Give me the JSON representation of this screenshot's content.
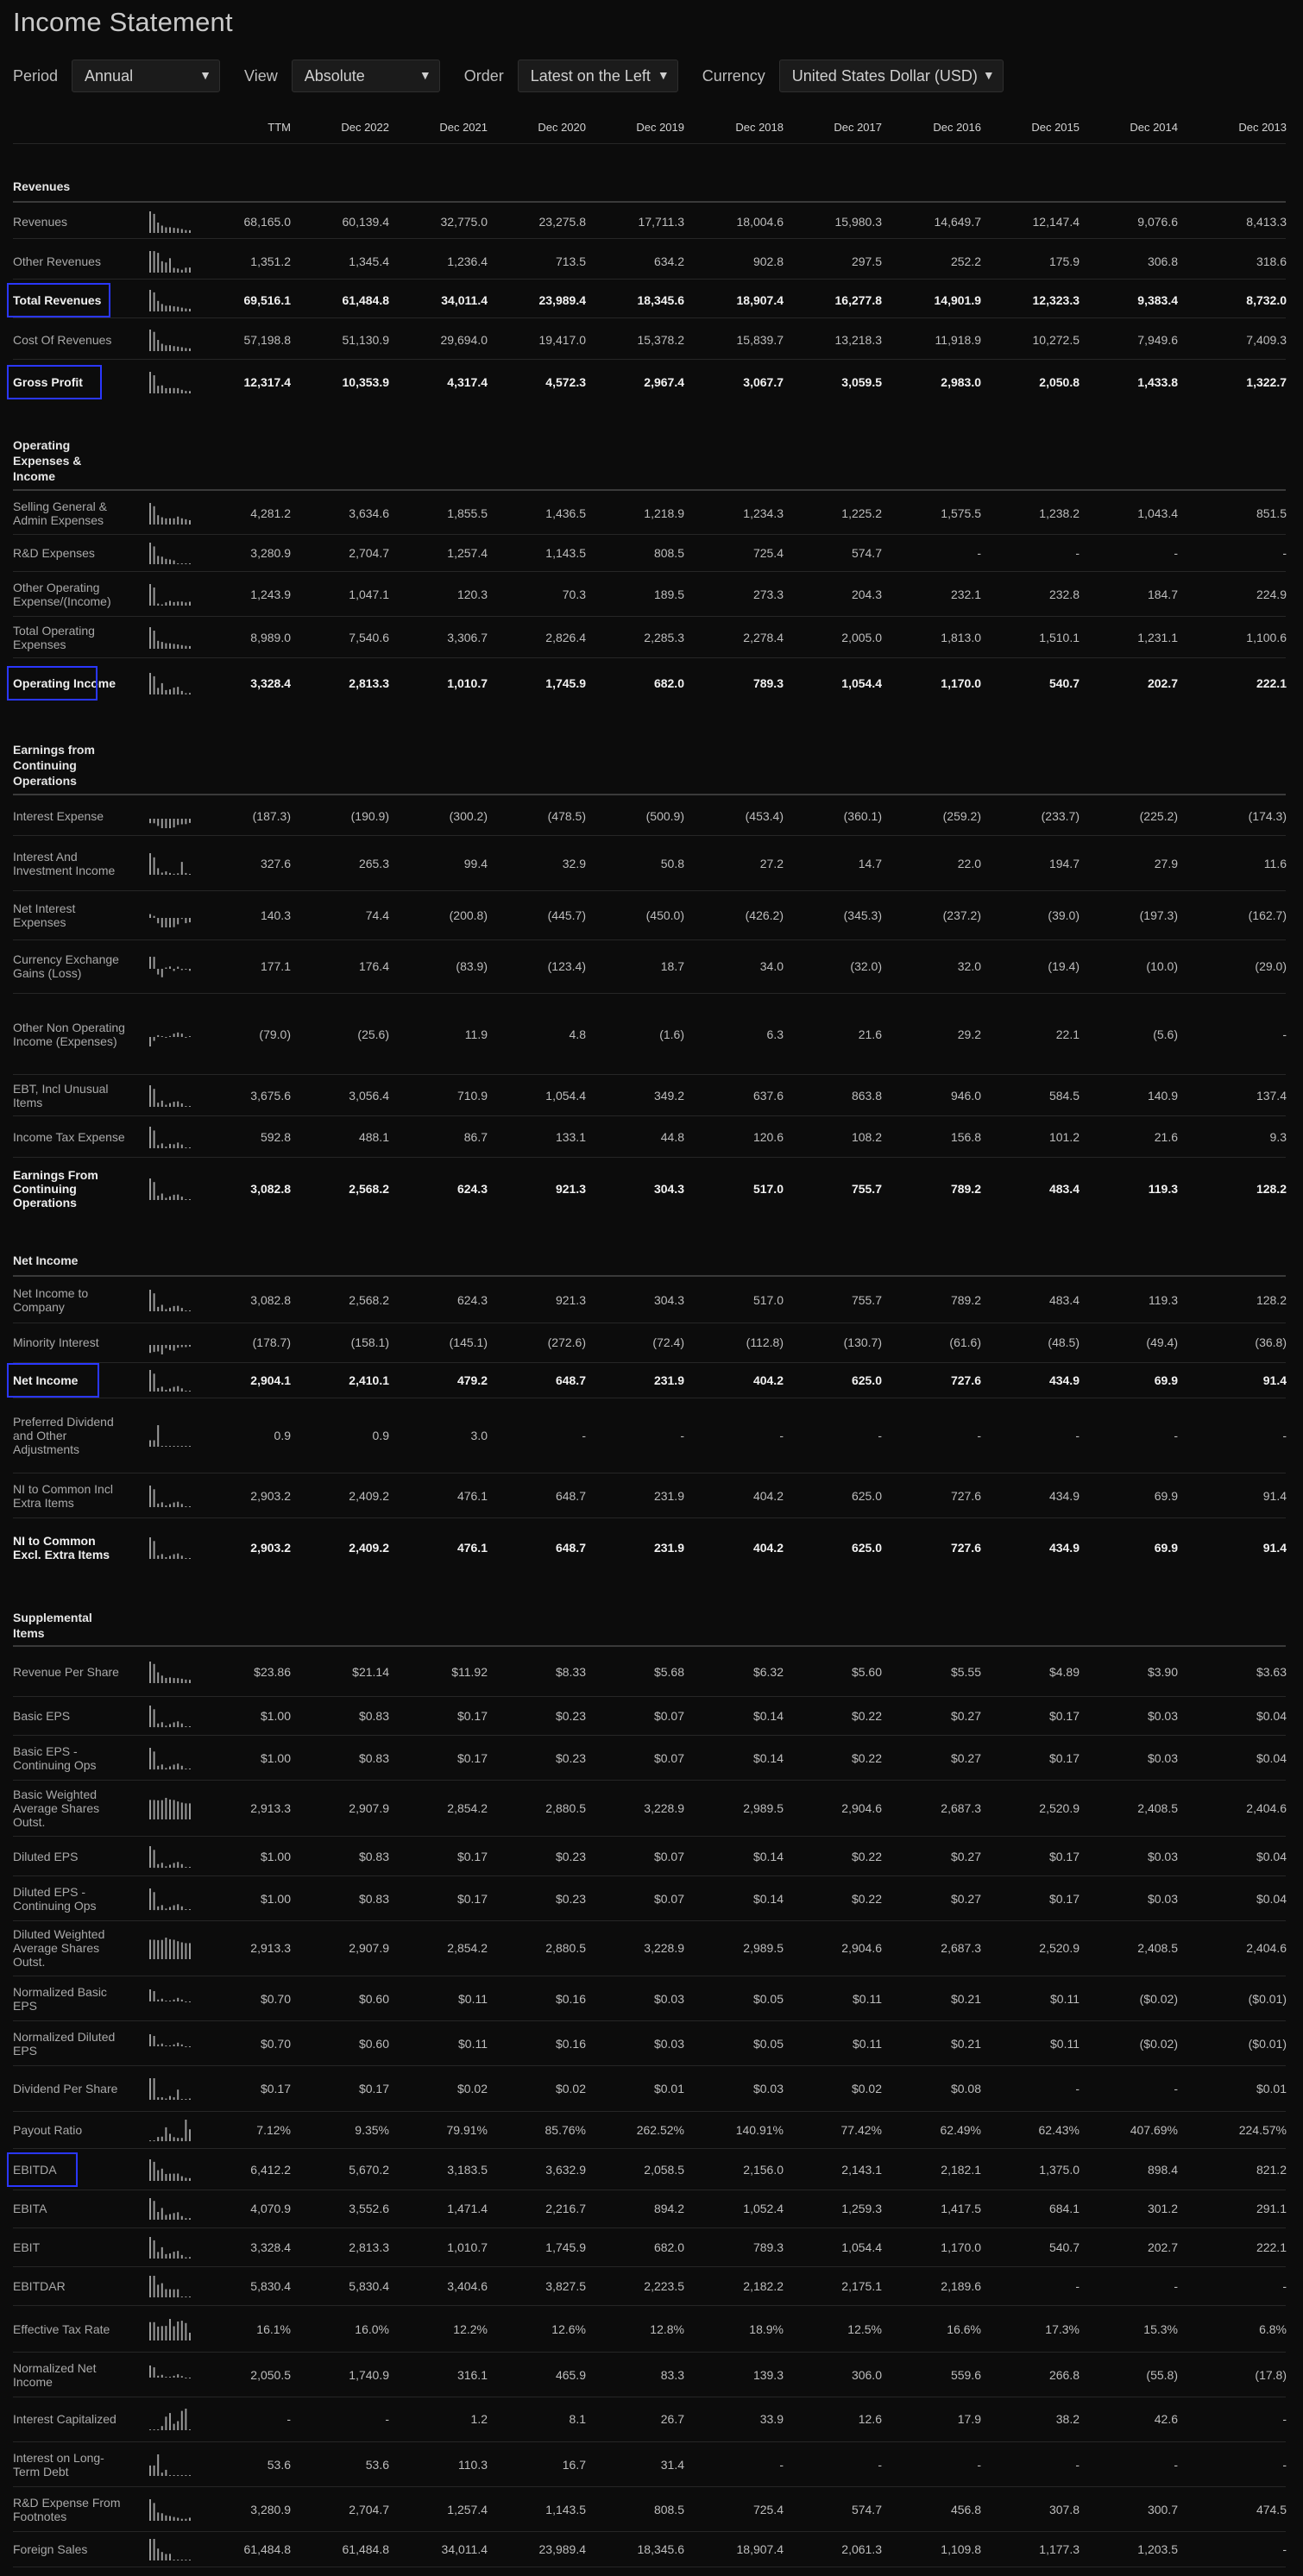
{
  "title": "Income Statement",
  "controls": {
    "period_label": "Period",
    "period_value": "Annual",
    "view_label": "View",
    "view_value": "Absolute",
    "order_label": "Order",
    "order_value": "Latest on the Left",
    "currency_label": "Currency",
    "currency_value": "United States Dollar (USD)"
  },
  "columns": [
    "TTM",
    "Dec 2022",
    "Dec 2021",
    "Dec 2020",
    "Dec 2019",
    "Dec 2018",
    "Dec 2017",
    "Dec 2016",
    "Dec 2015",
    "Dec 2014",
    "Dec 2013"
  ],
  "sections": [
    {
      "title": "Revenues",
      "rows": [
        {
          "label": "Revenues",
          "bold": false,
          "highlight": false,
          "values": [
            "68,165.0",
            "60,139.4",
            "32,775.0",
            "23,275.8",
            "17,711.3",
            "18,004.6",
            "15,980.3",
            "14,649.7",
            "12,147.4",
            "9,076.6",
            "8,413.3"
          ]
        },
        {
          "label": "Other Revenues",
          "bold": false,
          "highlight": false,
          "values": [
            "1,351.2",
            "1,345.4",
            "1,236.4",
            "713.5",
            "634.2",
            "902.8",
            "297.5",
            "252.2",
            "175.9",
            "306.8",
            "318.6"
          ]
        },
        {
          "label": "Total Revenues",
          "bold": true,
          "highlight": true,
          "values": [
            "69,516.1",
            "61,484.8",
            "34,011.4",
            "23,989.4",
            "18,345.6",
            "18,907.4",
            "16,277.8",
            "14,901.9",
            "12,323.3",
            "9,383.4",
            "8,732.0"
          ]
        },
        {
          "label": "Cost Of Revenues",
          "bold": false,
          "highlight": false,
          "values": [
            "57,198.8",
            "51,130.9",
            "29,694.0",
            "19,417.0",
            "15,378.2",
            "15,839.7",
            "13,218.3",
            "11,918.9",
            "10,272.5",
            "7,949.6",
            "7,409.3"
          ]
        },
        {
          "label": "Gross Profit",
          "bold": true,
          "highlight": true,
          "values": [
            "12,317.4",
            "10,353.9",
            "4,317.4",
            "4,572.3",
            "2,967.4",
            "3,067.7",
            "3,059.5",
            "2,983.0",
            "2,050.8",
            "1,433.8",
            "1,322.7"
          ]
        }
      ]
    },
    {
      "title": "Operating Expenses & Income",
      "rows": [
        {
          "label": "Selling General & Admin Expenses",
          "bold": false,
          "highlight": false,
          "values": [
            "4,281.2",
            "3,634.6",
            "1,855.5",
            "1,436.5",
            "1,218.9",
            "1,234.3",
            "1,225.2",
            "1,575.5",
            "1,238.2",
            "1,043.4",
            "851.5"
          ]
        },
        {
          "label": "R&D Expenses",
          "bold": false,
          "highlight": false,
          "values": [
            "3,280.9",
            "2,704.7",
            "1,257.4",
            "1,143.5",
            "808.5",
            "725.4",
            "574.7",
            "-",
            "-",
            "-",
            "-"
          ]
        },
        {
          "label": "Other Operating Expense/(Income)",
          "bold": false,
          "highlight": false,
          "values": [
            "1,243.9",
            "1,047.1",
            "120.3",
            "70.3",
            "189.5",
            "273.3",
            "204.3",
            "232.1",
            "232.8",
            "184.7",
            "224.9"
          ]
        },
        {
          "label": "Total Operating Expenses",
          "bold": false,
          "highlight": false,
          "values": [
            "8,989.0",
            "7,540.6",
            "3,306.7",
            "2,826.4",
            "2,285.3",
            "2,278.4",
            "2,005.0",
            "1,813.0",
            "1,510.1",
            "1,231.1",
            "1,100.6"
          ]
        },
        {
          "label": "Operating Income",
          "bold": true,
          "highlight": true,
          "values": [
            "3,328.4",
            "2,813.3",
            "1,010.7",
            "1,745.9",
            "682.0",
            "789.3",
            "1,054.4",
            "1,170.0",
            "540.7",
            "202.7",
            "222.1"
          ]
        }
      ]
    },
    {
      "title": "Earnings from Continuing Operations",
      "rows": [
        {
          "label": "Interest Expense",
          "bold": false,
          "highlight": false,
          "values": [
            "(187.3)",
            "(190.9)",
            "(300.2)",
            "(478.5)",
            "(500.9)",
            "(453.4)",
            "(360.1)",
            "(259.2)",
            "(233.7)",
            "(225.2)",
            "(174.3)"
          ]
        },
        {
          "label": "Interest And Investment Income",
          "bold": false,
          "highlight": false,
          "values": [
            "327.6",
            "265.3",
            "99.4",
            "32.9",
            "50.8",
            "27.2",
            "14.7",
            "22.0",
            "194.7",
            "27.9",
            "11.6"
          ]
        },
        {
          "label": "Net Interest Expenses",
          "bold": false,
          "highlight": false,
          "values": [
            "140.3",
            "74.4",
            "(200.8)",
            "(445.7)",
            "(450.0)",
            "(426.2)",
            "(345.3)",
            "(237.2)",
            "(39.0)",
            "(197.3)",
            "(162.7)"
          ]
        },
        {
          "label": "Currency Exchange Gains (Loss)",
          "bold": false,
          "highlight": false,
          "values": [
            "177.1",
            "176.4",
            "(83.9)",
            "(123.4)",
            "18.7",
            "34.0",
            "(32.0)",
            "32.0",
            "(19.4)",
            "(10.0)",
            "(29.0)"
          ]
        },
        {
          "label": "Other Non Operating Income (Expenses)",
          "bold": false,
          "highlight": false,
          "values": [
            "(79.0)",
            "(25.6)",
            "11.9",
            "4.8",
            "(1.6)",
            "6.3",
            "21.6",
            "29.2",
            "22.1",
            "(5.6)",
            "-"
          ]
        },
        {
          "label": "EBT, Incl Unusual Items",
          "bold": false,
          "highlight": false,
          "values": [
            "3,675.6",
            "3,056.4",
            "710.9",
            "1,054.4",
            "349.2",
            "637.6",
            "863.8",
            "946.0",
            "584.5",
            "140.9",
            "137.4"
          ]
        },
        {
          "label": "Income Tax Expense",
          "bold": false,
          "highlight": false,
          "values": [
            "592.8",
            "488.1",
            "86.7",
            "133.1",
            "44.8",
            "120.6",
            "108.2",
            "156.8",
            "101.2",
            "21.6",
            "9.3"
          ]
        },
        {
          "label": "Earnings From Continuing Operations",
          "bold": true,
          "highlight": false,
          "values": [
            "3,082.8",
            "2,568.2",
            "624.3",
            "921.3",
            "304.3",
            "517.0",
            "755.7",
            "789.2",
            "483.4",
            "119.3",
            "128.2"
          ]
        }
      ]
    },
    {
      "title": "Net Income",
      "rows": [
        {
          "label": "Net Income to Company",
          "bold": false,
          "highlight": false,
          "values": [
            "3,082.8",
            "2,568.2",
            "624.3",
            "921.3",
            "304.3",
            "517.0",
            "755.7",
            "789.2",
            "483.4",
            "119.3",
            "128.2"
          ]
        },
        {
          "label": "Minority Interest",
          "bold": false,
          "highlight": false,
          "values": [
            "(178.7)",
            "(158.1)",
            "(145.1)",
            "(272.6)",
            "(72.4)",
            "(112.8)",
            "(130.7)",
            "(61.6)",
            "(48.5)",
            "(49.4)",
            "(36.8)"
          ]
        },
        {
          "label": "Net Income",
          "bold": true,
          "highlight": true,
          "values": [
            "2,904.1",
            "2,410.1",
            "479.2",
            "648.7",
            "231.9",
            "404.2",
            "625.0",
            "727.6",
            "434.9",
            "69.9",
            "91.4"
          ]
        },
        {
          "label": "Preferred Dividend and Other Adjustments",
          "bold": false,
          "highlight": false,
          "values": [
            "0.9",
            "0.9",
            "3.0",
            "-",
            "-",
            "-",
            "-",
            "-",
            "-",
            "-",
            "-"
          ]
        },
        {
          "label": "NI to Common Incl Extra Items",
          "bold": false,
          "highlight": false,
          "values": [
            "2,903.2",
            "2,409.2",
            "476.1",
            "648.7",
            "231.9",
            "404.2",
            "625.0",
            "727.6",
            "434.9",
            "69.9",
            "91.4"
          ]
        },
        {
          "label": "NI to Common Excl. Extra Items",
          "bold": true,
          "highlight": false,
          "values": [
            "2,903.2",
            "2,409.2",
            "476.1",
            "648.7",
            "231.9",
            "404.2",
            "625.0",
            "727.6",
            "434.9",
            "69.9",
            "91.4"
          ]
        }
      ]
    },
    {
      "title": "Supplemental Items",
      "rows": [
        {
          "label": "Revenue Per Share",
          "bold": false,
          "highlight": false,
          "values": [
            "$23.86",
            "$21.14",
            "$11.92",
            "$8.33",
            "$5.68",
            "$6.32",
            "$5.60",
            "$5.55",
            "$4.89",
            "$3.90",
            "$3.63"
          ]
        },
        {
          "label": "Basic EPS",
          "bold": false,
          "highlight": false,
          "values": [
            "$1.00",
            "$0.83",
            "$0.17",
            "$0.23",
            "$0.07",
            "$0.14",
            "$0.22",
            "$0.27",
            "$0.17",
            "$0.03",
            "$0.04"
          ]
        },
        {
          "label": "Basic EPS - Continuing Ops",
          "bold": false,
          "highlight": false,
          "values": [
            "$1.00",
            "$0.83",
            "$0.17",
            "$0.23",
            "$0.07",
            "$0.14",
            "$0.22",
            "$0.27",
            "$0.17",
            "$0.03",
            "$0.04"
          ]
        },
        {
          "label": "Basic Weighted Average Shares Outst.",
          "bold": false,
          "highlight": false,
          "values": [
            "2,913.3",
            "2,907.9",
            "2,854.2",
            "2,880.5",
            "3,228.9",
            "2,989.5",
            "2,904.6",
            "2,687.3",
            "2,520.9",
            "2,408.5",
            "2,404.6"
          ]
        },
        {
          "label": "Diluted EPS",
          "bold": false,
          "highlight": false,
          "values": [
            "$1.00",
            "$0.83",
            "$0.17",
            "$0.23",
            "$0.07",
            "$0.14",
            "$0.22",
            "$0.27",
            "$0.17",
            "$0.03",
            "$0.04"
          ]
        },
        {
          "label": "Diluted EPS - Continuing Ops",
          "bold": false,
          "highlight": false,
          "values": [
            "$1.00",
            "$0.83",
            "$0.17",
            "$0.23",
            "$0.07",
            "$0.14",
            "$0.22",
            "$0.27",
            "$0.17",
            "$0.03",
            "$0.04"
          ]
        },
        {
          "label": "Diluted Weighted Average Shares Outst.",
          "bold": false,
          "highlight": false,
          "values": [
            "2,913.3",
            "2,907.9",
            "2,854.2",
            "2,880.5",
            "3,228.9",
            "2,989.5",
            "2,904.6",
            "2,687.3",
            "2,520.9",
            "2,408.5",
            "2,404.6"
          ]
        },
        {
          "label": "Normalized Basic EPS",
          "bold": false,
          "highlight": false,
          "values": [
            "$0.70",
            "$0.60",
            "$0.11",
            "$0.16",
            "$0.03",
            "$0.05",
            "$0.11",
            "$0.21",
            "$0.11",
            "($0.02)",
            "($0.01)"
          ]
        },
        {
          "label": "Normalized Diluted EPS",
          "bold": false,
          "highlight": false,
          "values": [
            "$0.70",
            "$0.60",
            "$0.11",
            "$0.16",
            "$0.03",
            "$0.05",
            "$0.11",
            "$0.21",
            "$0.11",
            "($0.02)",
            "($0.01)"
          ]
        },
        {
          "label": "Dividend Per Share",
          "bold": false,
          "highlight": false,
          "values": [
            "$0.17",
            "$0.17",
            "$0.02",
            "$0.02",
            "$0.01",
            "$0.03",
            "$0.02",
            "$0.08",
            "-",
            "-",
            "$0.01"
          ]
        },
        {
          "label": "Payout Ratio",
          "bold": false,
          "highlight": false,
          "values": [
            "7.12%",
            "9.35%",
            "79.91%",
            "85.76%",
            "262.52%",
            "140.91%",
            "77.42%",
            "62.49%",
            "62.43%",
            "407.69%",
            "224.57%"
          ]
        },
        {
          "label": "EBITDA",
          "bold": false,
          "highlight": true,
          "values": [
            "6,412.2",
            "5,670.2",
            "3,183.5",
            "3,632.9",
            "2,058.5",
            "2,156.0",
            "2,143.1",
            "2,182.1",
            "1,375.0",
            "898.4",
            "821.2"
          ]
        },
        {
          "label": "EBITA",
          "bold": false,
          "highlight": false,
          "values": [
            "4,070.9",
            "3,552.6",
            "1,471.4",
            "2,216.7",
            "894.2",
            "1,052.4",
            "1,259.3",
            "1,417.5",
            "684.1",
            "301.2",
            "291.1"
          ]
        },
        {
          "label": "EBIT",
          "bold": false,
          "highlight": false,
          "values": [
            "3,328.4",
            "2,813.3",
            "1,010.7",
            "1,745.9",
            "682.0",
            "789.3",
            "1,054.4",
            "1,170.0",
            "540.7",
            "202.7",
            "222.1"
          ]
        },
        {
          "label": "EBITDAR",
          "bold": false,
          "highlight": false,
          "values": [
            "5,830.4",
            "5,830.4",
            "3,404.6",
            "3,827.5",
            "2,223.5",
            "2,182.2",
            "2,175.1",
            "2,189.6",
            "-",
            "-",
            "-"
          ]
        },
        {
          "label": "Effective Tax Rate",
          "bold": false,
          "highlight": false,
          "values": [
            "16.1%",
            "16.0%",
            "12.2%",
            "12.6%",
            "12.8%",
            "18.9%",
            "12.5%",
            "16.6%",
            "17.3%",
            "15.3%",
            "6.8%"
          ]
        },
        {
          "label": "Normalized Net Income",
          "bold": false,
          "highlight": false,
          "values": [
            "2,050.5",
            "1,740.9",
            "316.1",
            "465.9",
            "83.3",
            "139.3",
            "306.0",
            "559.6",
            "266.8",
            "(55.8)",
            "(17.8)"
          ]
        },
        {
          "label": "Interest Capitalized",
          "bold": false,
          "highlight": false,
          "values": [
            "-",
            "-",
            "1.2",
            "8.1",
            "26.7",
            "33.9",
            "12.6",
            "17.9",
            "38.2",
            "42.6",
            "-"
          ]
        },
        {
          "label": "Interest on Long-Term Debt",
          "bold": false,
          "highlight": false,
          "values": [
            "53.6",
            "53.6",
            "110.3",
            "16.7",
            "31.4",
            "-",
            "-",
            "-",
            "-",
            "-",
            "-"
          ]
        },
        {
          "label": "R&D Expense From Footnotes",
          "bold": false,
          "highlight": false,
          "values": [
            "3,280.9",
            "2,704.7",
            "1,257.4",
            "1,143.5",
            "808.5",
            "725.4",
            "574.7",
            "456.8",
            "307.8",
            "300.7",
            "474.5"
          ]
        },
        {
          "label": "Foreign Sales",
          "bold": false,
          "highlight": false,
          "values": [
            "61,484.8",
            "61,484.8",
            "34,011.4",
            "23,989.4",
            "18,345.6",
            "18,907.4",
            "2,061.3",
            "1,109.8",
            "1,177.3",
            "1,203.5",
            "-"
          ]
        }
      ]
    }
  ]
}
